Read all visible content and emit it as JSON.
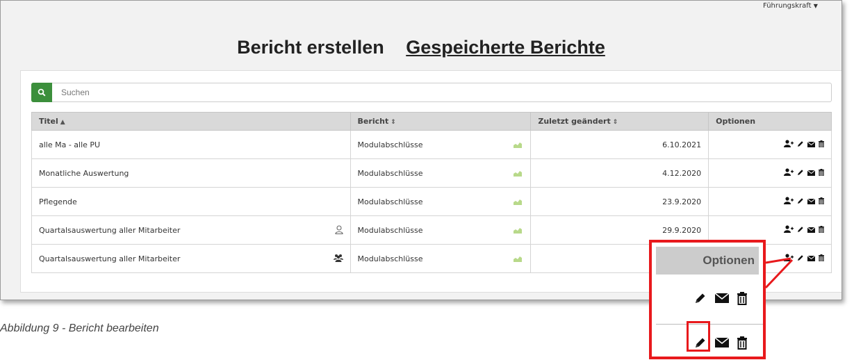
{
  "header": {
    "role_menu": "Führungskraft",
    "title_create": "Bericht erstellen",
    "title_saved": "Gespeicherte Berichte"
  },
  "search": {
    "placeholder": "Suchen"
  },
  "table": {
    "columns": {
      "titel": "Titel",
      "bericht": "Bericht",
      "zuletzt": "Zuletzt geändert",
      "optionen": "Optionen"
    },
    "rows": [
      {
        "titel": "alle Ma - alle PU",
        "bericht": "Modulabschlüsse",
        "datum": "6.10.2021",
        "owner_icon": ""
      },
      {
        "titel": "Monatliche Auswertung",
        "bericht": "Modulabschlüsse",
        "datum": "4.12.2020",
        "owner_icon": ""
      },
      {
        "titel": "Pflegende",
        "bericht": "Modulabschlüsse",
        "datum": "23.9.2020",
        "owner_icon": ""
      },
      {
        "titel": "Quartalsauswertung aller Mitarbeiter",
        "bericht": "Modulabschlüsse",
        "datum": "29.9.2020",
        "owner_icon": "user-outline-icon"
      },
      {
        "titel": "Quartalsauswertung aller Mitarbeiter",
        "bericht": "Modulabschlüsse",
        "datum": "",
        "owner_icon": "users-group-icon"
      }
    ]
  },
  "zoom": {
    "header": "Optionen"
  },
  "caption": "Abbildung 9 - Bericht bearbeiten",
  "colors": {
    "search_button": "#3c8f3c",
    "highlight": "#e8191c",
    "header_bg": "#d9d9d9"
  }
}
